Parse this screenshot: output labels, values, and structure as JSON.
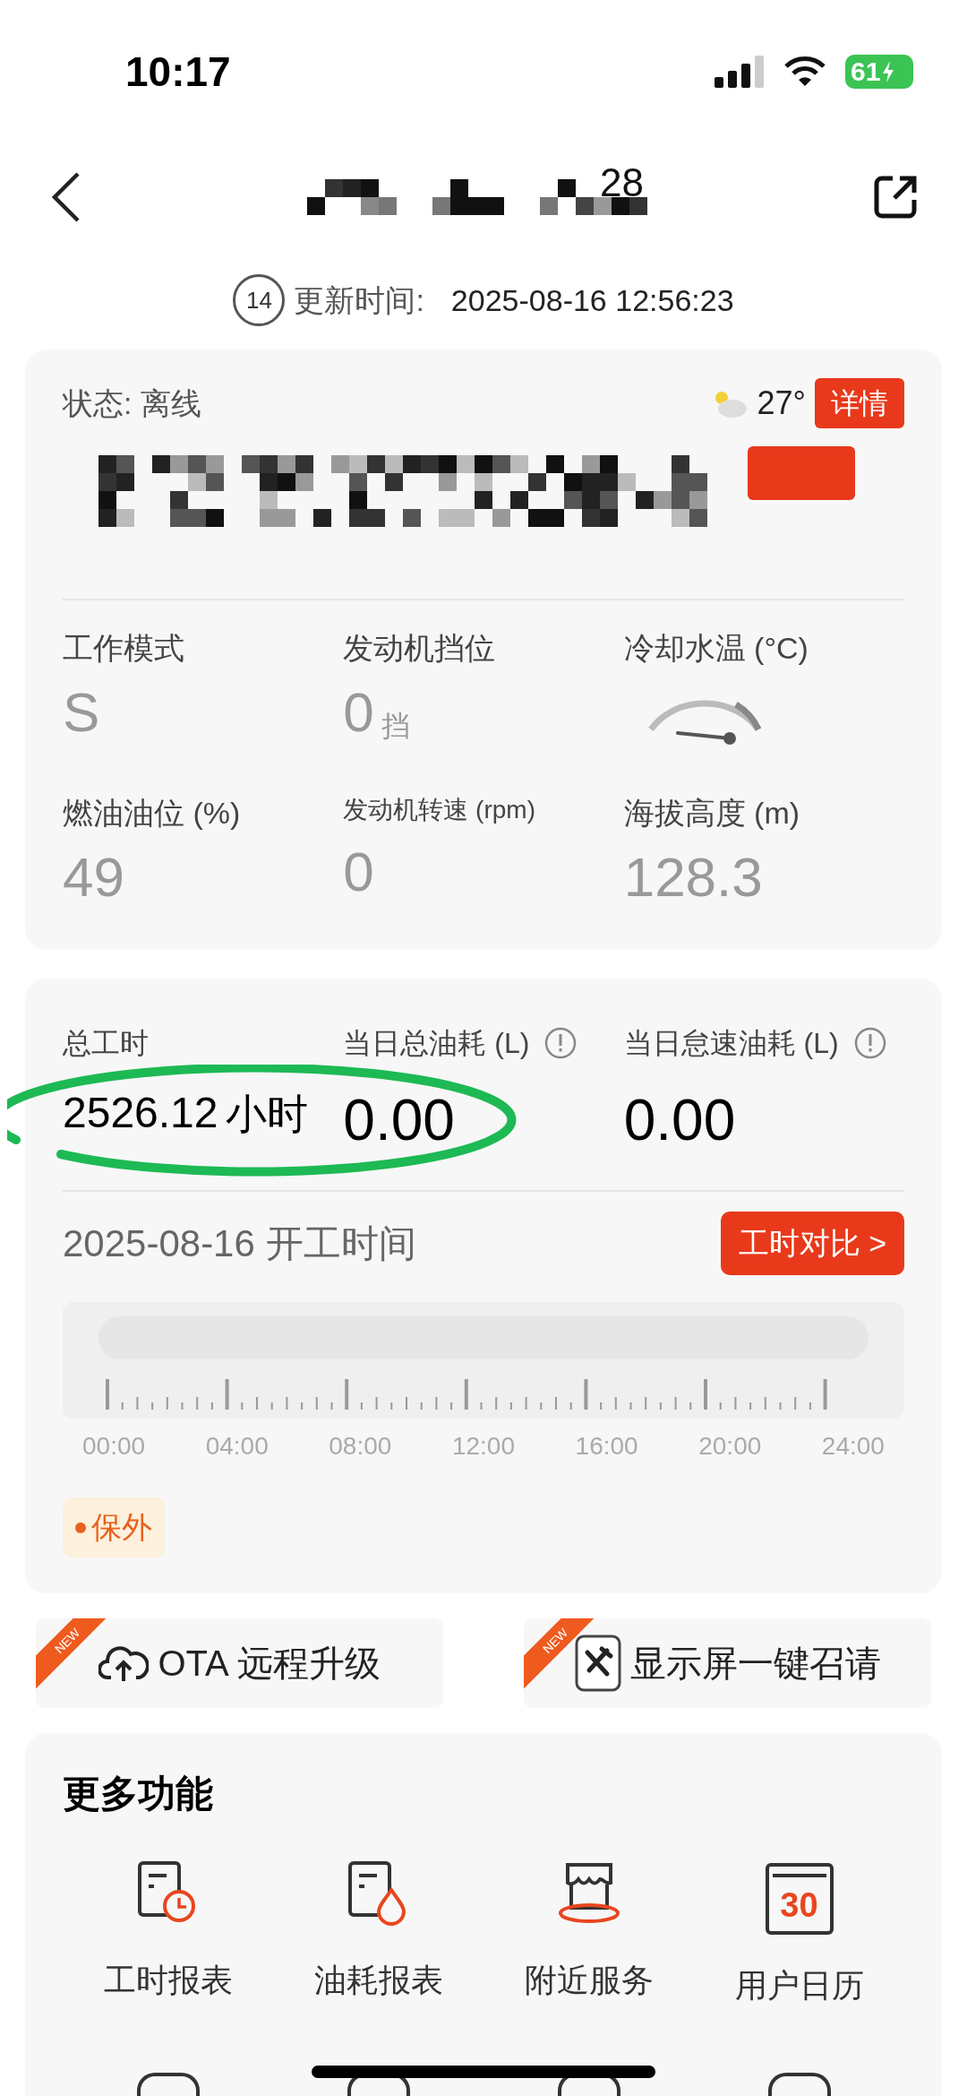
{
  "status_bar": {
    "time": "10:17",
    "battery": "61"
  },
  "nav": {
    "title_visible": "28"
  },
  "update": {
    "countdown": "14",
    "label": "更新时间:",
    "time": "2025-08-16 12:56:23"
  },
  "status_card": {
    "status": "状态: 离线",
    "temperature": "27°",
    "detail_button": "详情",
    "metrics": [
      {
        "kind": "text",
        "label": "工作模式",
        "value": "S"
      },
      {
        "kind": "text",
        "label": "发动机挡位",
        "value": "0",
        "unit": "挡"
      },
      {
        "kind": "gauge",
        "label": "冷却水温 (°C)"
      },
      {
        "kind": "text",
        "label": "燃油油位 (%)",
        "value": "49"
      },
      {
        "kind": "text",
        "label": "发动机转速 (rpm)",
        "value": "0",
        "small": true
      },
      {
        "kind": "text",
        "label": "海拔高度 (m)",
        "value": "128.3"
      }
    ]
  },
  "work_card": {
    "stats": [
      {
        "label": "总工时",
        "value": "2526.12",
        "unit": "小时",
        "info": false
      },
      {
        "label": "当日总油耗 (L)",
        "value": "0.00",
        "info": true
      },
      {
        "label": "当日怠速油耗 (L)",
        "value": "0.00",
        "info": true
      }
    ],
    "date_title": "2025-08-16 开工时间",
    "compare_button": "工时对比 >",
    "ticks": [
      "00:00",
      "04:00",
      "08:00",
      "12:00",
      "16:00",
      "20:00",
      "24:00"
    ],
    "warranty": "保外"
  },
  "feature_buttons": [
    {
      "label": "OTA 远程升级",
      "badge": "NEW",
      "kind": "cloud"
    },
    {
      "label": "显示屏一键召请",
      "badge": "NEW",
      "kind": "tools"
    }
  ],
  "more": {
    "title": "更多功能",
    "items": [
      {
        "label": "工时报表",
        "kind": "clock"
      },
      {
        "label": "油耗报表",
        "kind": "drop"
      },
      {
        "label": "附近服务",
        "kind": "shop"
      },
      {
        "label": "用户日历",
        "kind": "calendar",
        "icon_text": "30"
      }
    ]
  }
}
